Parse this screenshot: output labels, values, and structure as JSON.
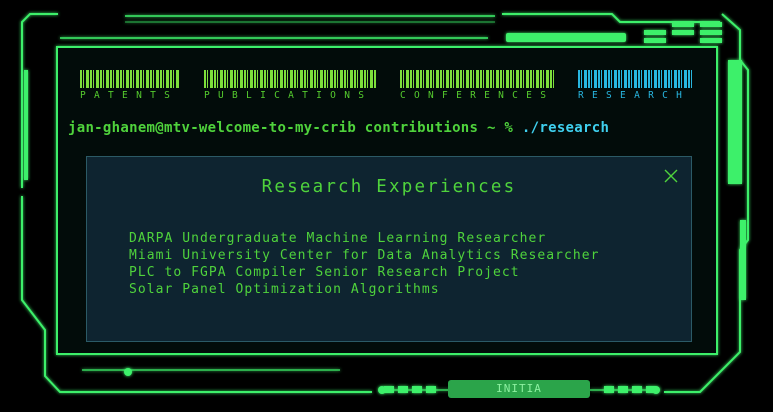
{
  "tabs": [
    {
      "label": "PATENTS",
      "active": false
    },
    {
      "label": "PUBLICATIONS",
      "active": false
    },
    {
      "label": "CONFERENCES",
      "active": false
    },
    {
      "label": "RESEARCH",
      "active": true
    }
  ],
  "prompt": {
    "text": "jan-ghanem@mtv-welcome-to-my-crib contributions ~ %",
    "command": "./research"
  },
  "modal": {
    "title": "Research Experiences",
    "items": [
      "DARPA Undergraduate Machine Learning Researcher",
      "Miami University Center for Data Analytics Researcher",
      "PLC to FGPA Compiler Senior Research Project",
      "Solar Panel Optimization Algorithms"
    ]
  },
  "footer": {
    "button_label": "INITIA"
  },
  "colors": {
    "accent_green": "#4fd33c",
    "accent_cyan": "#3fd0ef",
    "modal_bg": "#0e2430",
    "frame_green": "#3df06a"
  }
}
